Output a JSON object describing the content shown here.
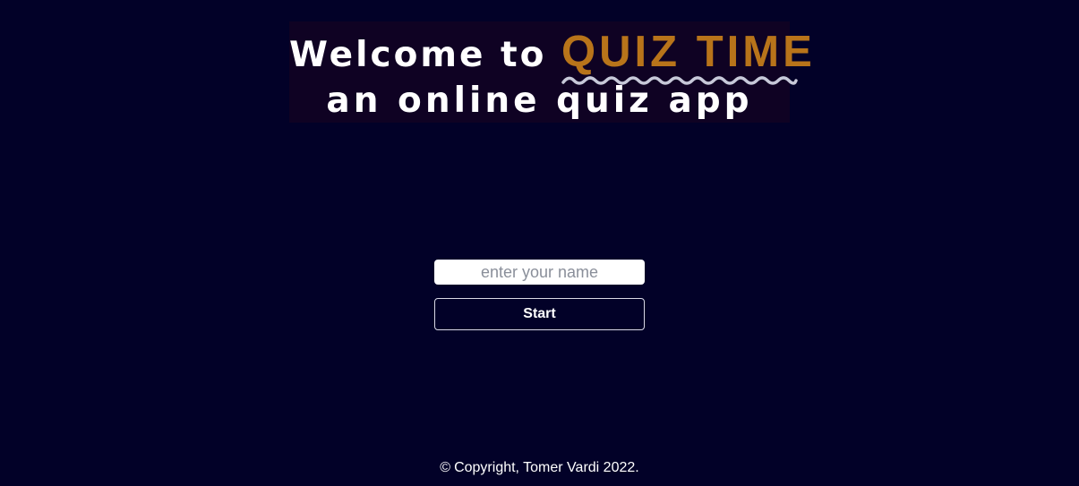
{
  "hero": {
    "line1_prefix": "Welcome to ",
    "line1_accent": "QUIZ TIME",
    "line2": "an online quiz app"
  },
  "form": {
    "name_placeholder": "enter your name",
    "name_value": "",
    "start_label": "Start"
  },
  "footer": {
    "copyright_icon": "copyright-icon",
    "text": "Copyright, Tomer Vardi 2022."
  },
  "colors": {
    "background": "#020128",
    "hero_background": "#0f0223",
    "accent": "#b8741a",
    "squiggle": "#c7c9d9",
    "text": "#ffffff"
  }
}
